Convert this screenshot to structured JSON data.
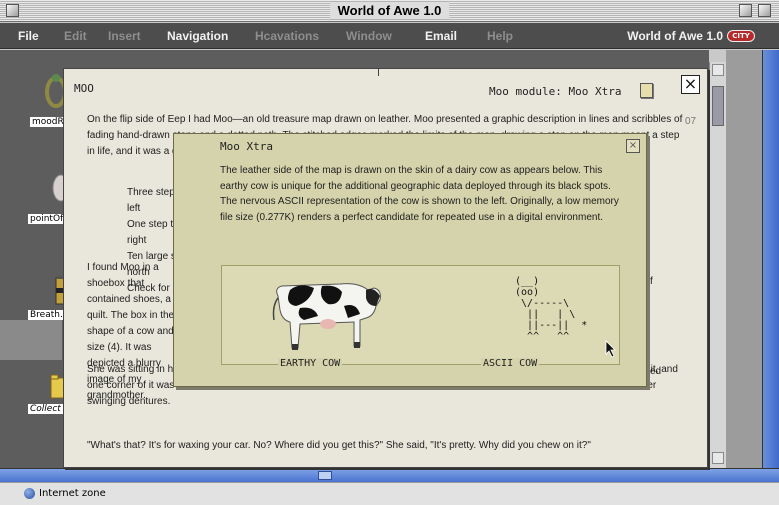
{
  "window": {
    "title": "World of Awe 1.0"
  },
  "menubar": {
    "items": [
      {
        "label": "File",
        "enabled": true
      },
      {
        "label": "Edit",
        "enabled": false
      },
      {
        "label": "Insert",
        "enabled": false
      },
      {
        "label": "Navigation",
        "enabled": true
      },
      {
        "label": "Hcavations",
        "enabled": false
      },
      {
        "label": "Window",
        "enabled": false
      },
      {
        "label": "Email",
        "enabled": true
      },
      {
        "label": "Help",
        "enabled": false
      }
    ],
    "brand": "World of Awe 1.0",
    "brand_logo": "CITY"
  },
  "desktop": {
    "icons": [
      {
        "label": "moodRi",
        "icon": "ring-icon"
      },
      {
        "label": "pointOf",
        "icon": "egg-icon"
      },
      {
        "label": "Breath...",
        "icon": "battery-icon"
      },
      {
        "label": "Collect",
        "icon": "folder-icon"
      }
    ]
  },
  "document": {
    "title": "MOO",
    "module_label": "Moo module: Moo Xtra",
    "p1": "On the flip side of Eep I had Moo—an old treasure map drawn on leather. Moo presented a graphic description in lines and scribbles of fading hand-drawn steps and a dotted path. The stitched edges marked the limits of the map, drawing a step on the map meant a step in life, and it was a guide that served me well through the weather was cold.",
    "steps": [
      "Three steps to the left",
      "One step to the right",
      "Ten large steps north",
      "Check for alignment"
    ],
    "p2": "I found Moo in a shoebox that contained shoes, a quilt. The box in the shape of a cow and size (4). It was depicted a blurry image of my grandmother.",
    "frag1": "f",
    "frag2": "ed",
    "frag3": "07",
    "p3": "She was sitting in her kitchen chair eating a sandwich when I showed her what was it and asked her what it was. She looked at it, and one corner of it was chewed off. I looked at my grandmother's sandwich, studying the curve she just left in the soft bread with her swinging dentures.",
    "p4": "\"What's that? It's for waxing your car. No? Where did you get this?\" She said, \"It's pretty. Why did you chew on it?\""
  },
  "popup": {
    "title": "Moo Xtra",
    "description": "The leather side of the map is drawn on the skin of a dairy cow as appears below. This earthy cow is unique for the additional geographic data deployed through its black spots. The nervous ASCII representation of the cow is shown to the left. Originally, a low memory file size (0.277K) renders a perfect candidate for repeated use in a digital environment.",
    "earthy_caption": "EARTHY COW",
    "ascii_caption": "ASCII COW",
    "ascii_art": " (__)\n (oo)\n  \\/-----\\\n   ||   | \\\n   ||---||  *\n   ^^   ^^"
  },
  "statusbar": {
    "zone": "Internet zone"
  },
  "colors": {
    "popup_bg": "#d5d3ab",
    "doc_bg": "#e9e7db",
    "menubar_bg": "#4d4d4d",
    "scroll_blue": "#4a73cf"
  }
}
